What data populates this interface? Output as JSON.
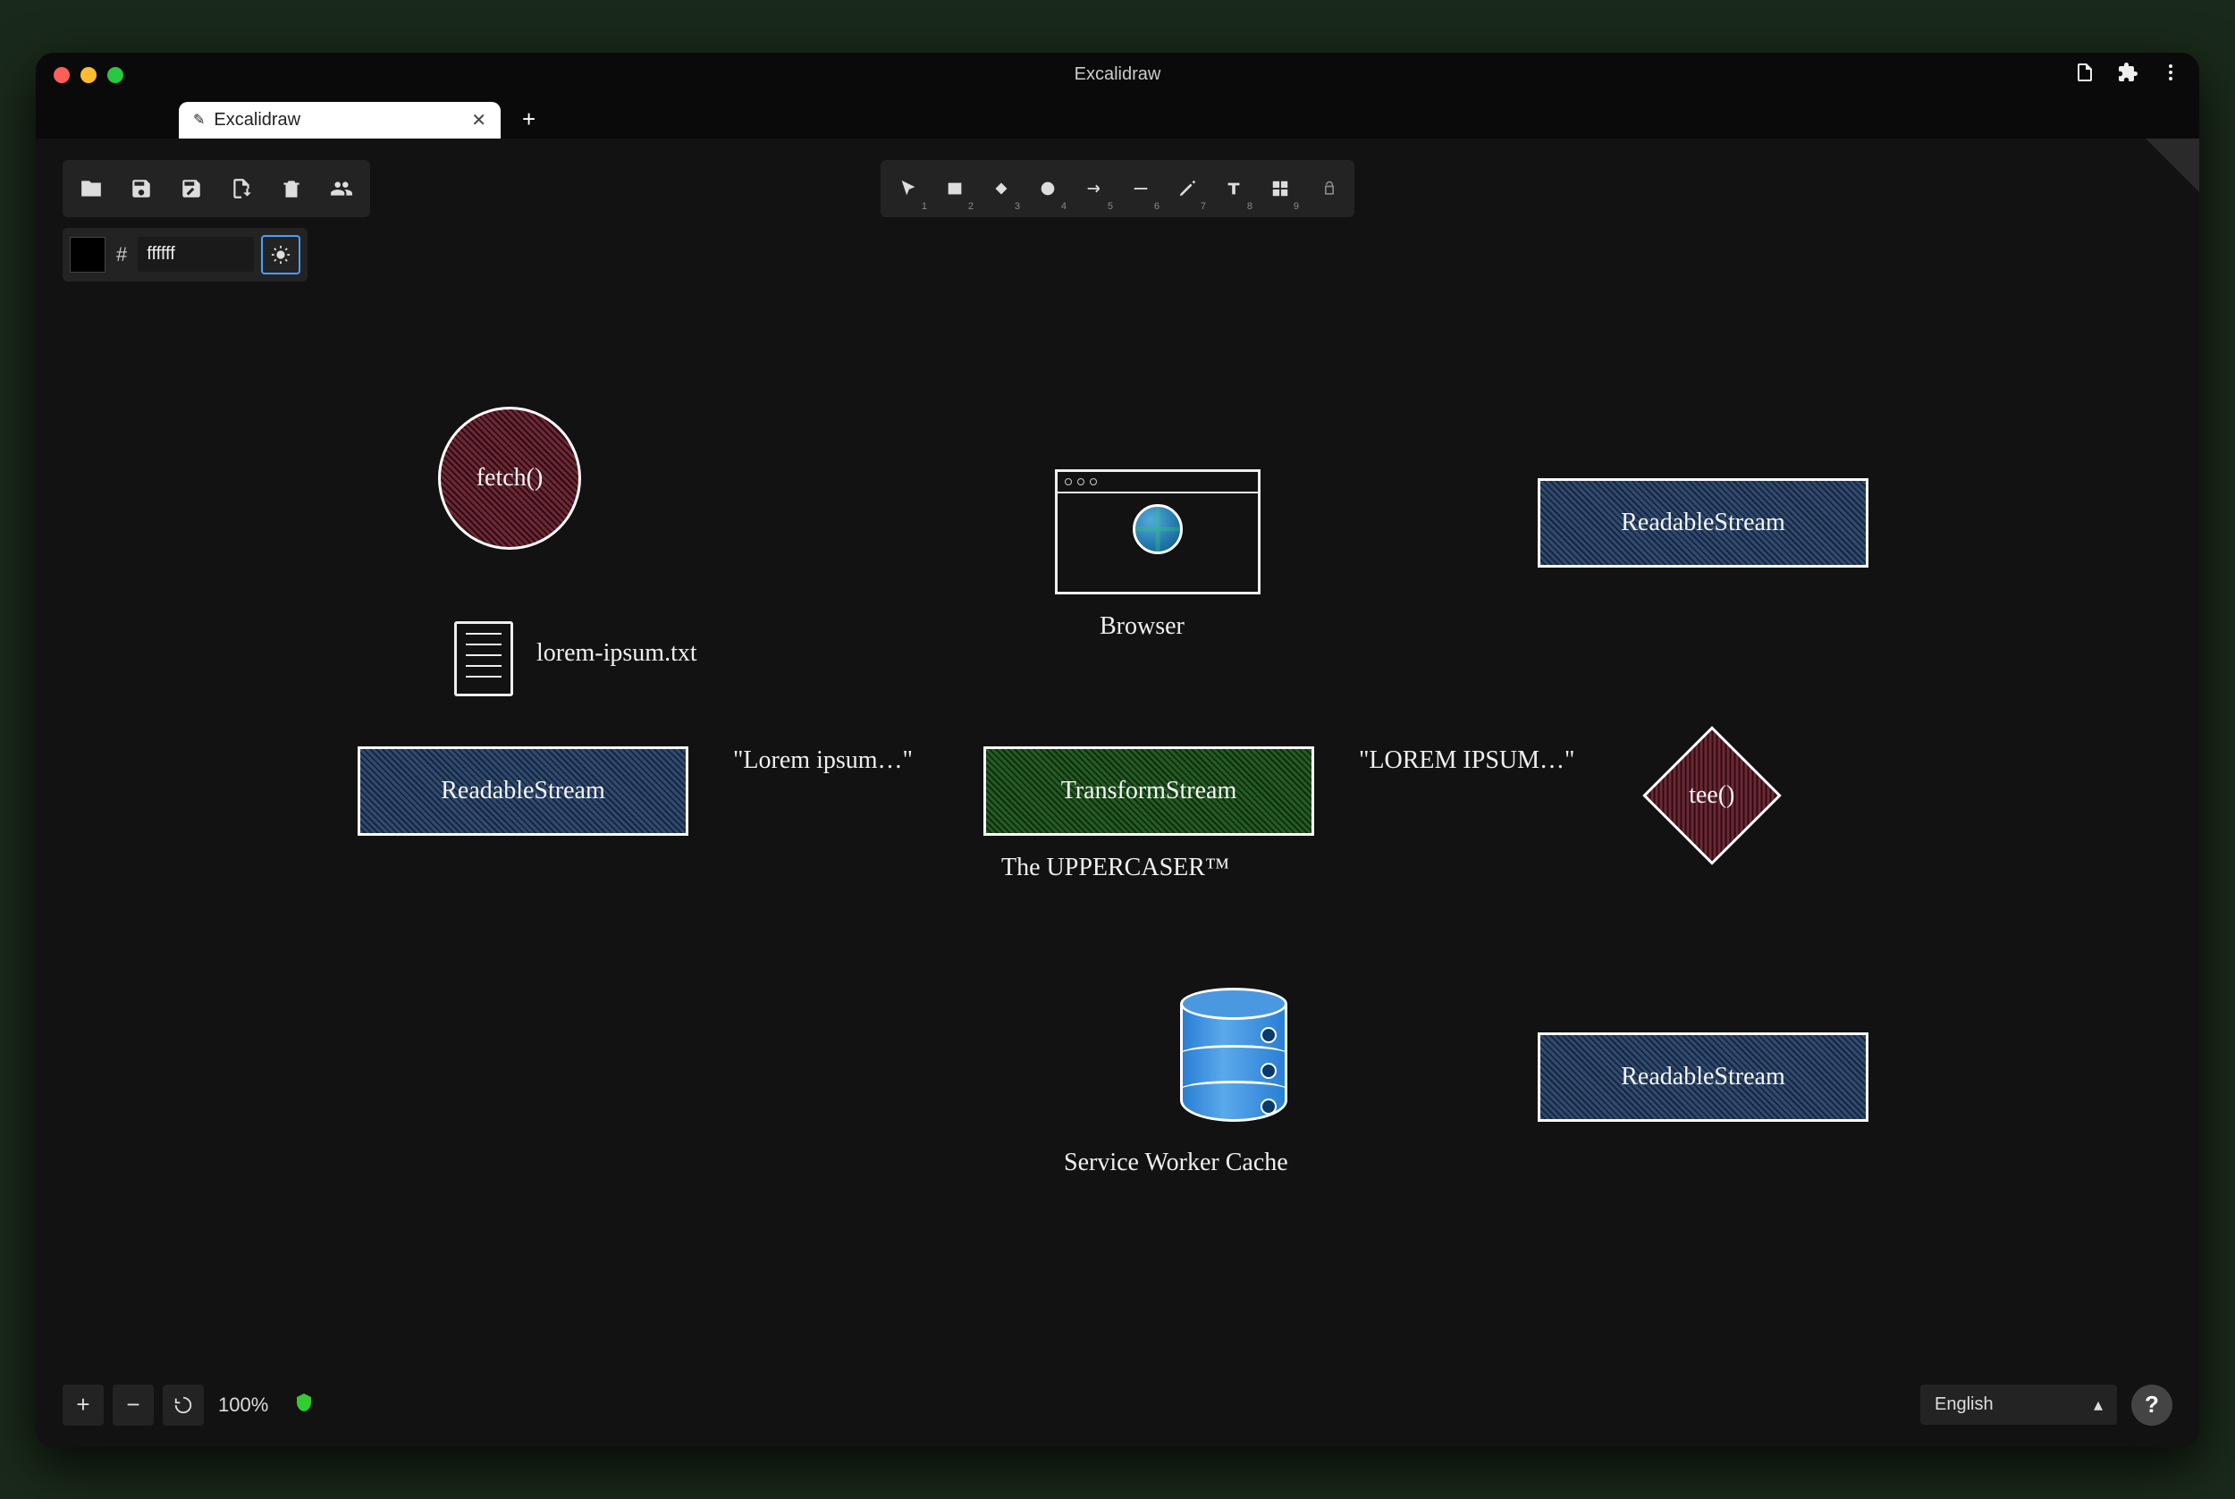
{
  "browser": {
    "title": "Excalidraw",
    "tab_label": "Excalidraw",
    "newtab": "+"
  },
  "toolbar": {
    "shapes": {
      "n1": "1",
      "n2": "2",
      "n3": "3",
      "n4": "4",
      "n5": "5",
      "n6": "6",
      "n7": "7",
      "n8": "8",
      "n9": "9"
    }
  },
  "color": {
    "hash": "#",
    "hex": "ffffff"
  },
  "zoom": {
    "level": "100%"
  },
  "lang": {
    "value": "English"
  },
  "diagram": {
    "fetch": "fetch()",
    "filename": "lorem-ipsum.txt",
    "readable1": "ReadableStream",
    "lorem": "\"Lorem ipsum…\"",
    "transform": "TransformStream",
    "uppercaser": "The UPPERCASER™",
    "lorem_upper": "\"LOREM IPSUM…\"",
    "tee": "tee()",
    "readable2": "ReadableStream",
    "readable3": "ReadableStream",
    "browser": "Browser",
    "swcache": "Service Worker Cache"
  }
}
